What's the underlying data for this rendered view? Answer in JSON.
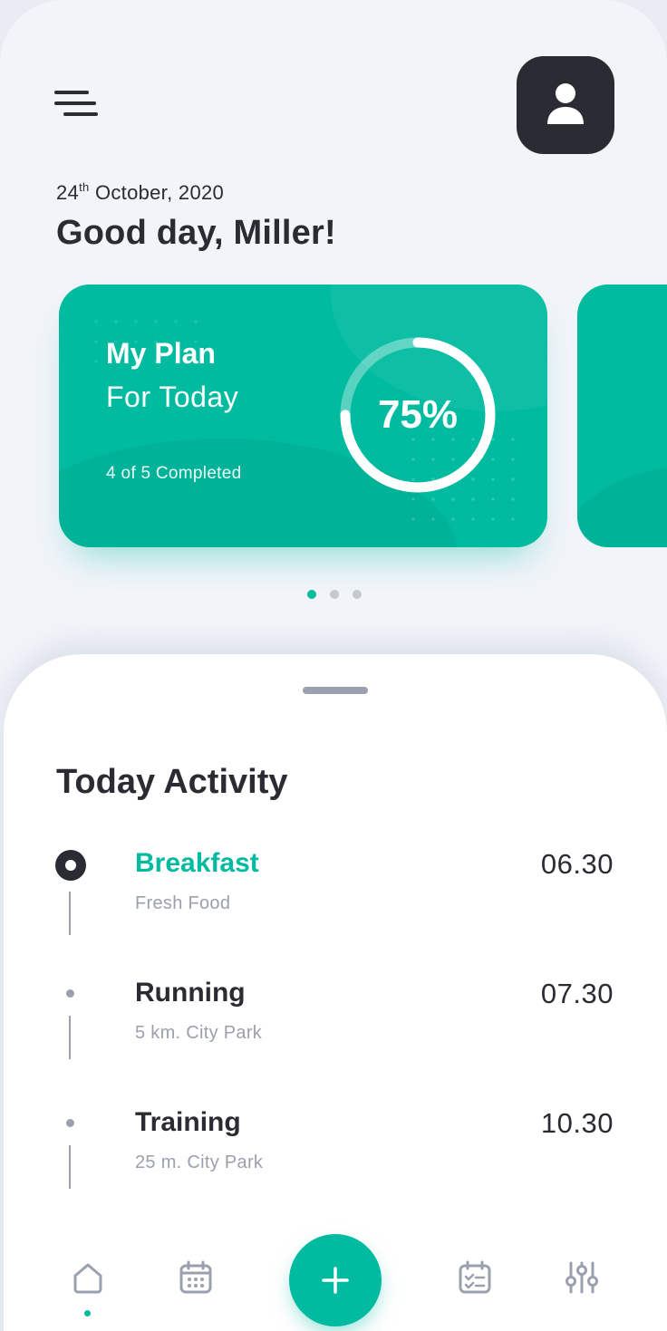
{
  "header": {
    "date_day": "24",
    "date_suffix": "th",
    "date_rest": " October, 2020",
    "greeting": "Good day, Miller!",
    "menu_icon": "hamburger-menu-icon",
    "profile_icon": "user-icon"
  },
  "plan_card": {
    "title": "My Plan",
    "subtitle": "For Today",
    "progress_text": "4 of 5 Completed",
    "percent_label": "75%",
    "percent_value": 0.75
  },
  "pager": {
    "count": 3,
    "active_index": 0
  },
  "activity": {
    "title": "Today Activity",
    "items": [
      {
        "name": "Breakfast",
        "detail": "Fresh Food",
        "time": "06.30",
        "current": true
      },
      {
        "name": "Running",
        "detail": "5 km. City Park",
        "time": "07.30",
        "current": false
      },
      {
        "name": "Training",
        "detail": "25 m. City Park",
        "time": "10.30",
        "current": false
      }
    ]
  },
  "nav": {
    "items": [
      {
        "icon": "home-icon",
        "active": true
      },
      {
        "icon": "calendar-icon",
        "active": false
      },
      {
        "icon": "plus-icon",
        "active": false
      },
      {
        "icon": "checklist-icon",
        "active": false
      },
      {
        "icon": "sliders-icon",
        "active": false
      }
    ]
  },
  "colors": {
    "accent": "#00bba0",
    "dark": "#2a2b33",
    "muted": "#9aa0ad",
    "background": "#f1f4f9"
  }
}
